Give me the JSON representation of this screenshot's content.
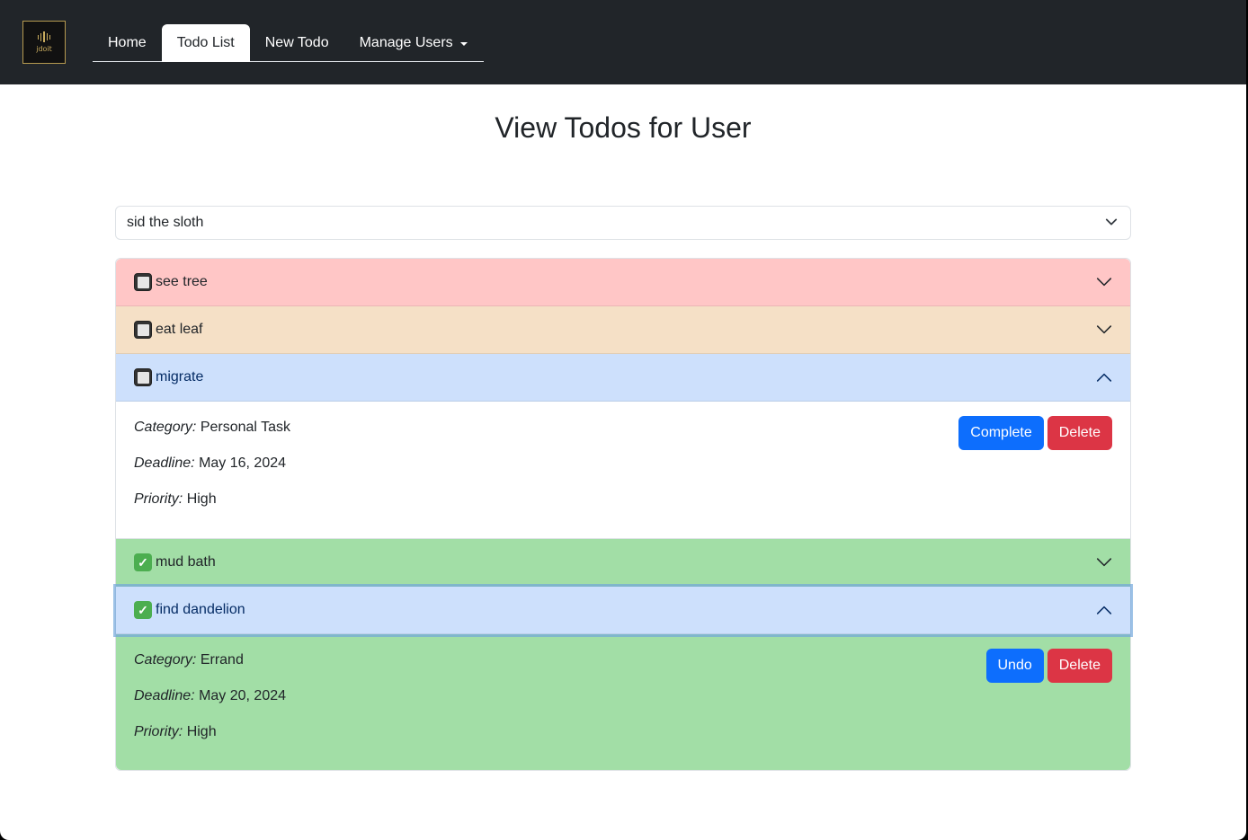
{
  "brand": {
    "logo_text": "jdoit"
  },
  "nav": {
    "tabs": [
      {
        "label": "Home"
      },
      {
        "label": "Todo List"
      },
      {
        "label": "New Todo"
      },
      {
        "label": "Manage Users"
      }
    ],
    "active_tab": "Todo List"
  },
  "page": {
    "title": "View Todos for User"
  },
  "user_select": {
    "selected": "sid the sloth"
  },
  "todos": [
    {
      "title": "see tree",
      "completed": false,
      "color": "#ffc6c6",
      "expanded": false
    },
    {
      "title": "eat leaf",
      "completed": false,
      "color": "#f5e0c6",
      "expanded": false
    },
    {
      "title": "migrate",
      "completed": false,
      "color": "#cde0fc",
      "expanded": true,
      "category_label": "Category:",
      "category": "Personal Task",
      "deadline_label": "Deadline:",
      "deadline": "May 16, 2024",
      "priority_label": "Priority:",
      "priority": "High",
      "primary_action": "Complete",
      "delete_action": "Delete"
    },
    {
      "title": "mud bath",
      "completed": true,
      "color": "#a2dea6",
      "expanded": false
    },
    {
      "title": "find dandelion",
      "completed": true,
      "color": "#cde0fc",
      "expanded": true,
      "category_label": "Category:",
      "category": "Errand",
      "deadline_label": "Deadline:",
      "deadline": "May 20, 2024",
      "priority_label": "Priority:",
      "priority": "High",
      "primary_action": "Undo",
      "delete_action": "Delete"
    }
  ],
  "colors": {
    "navbar": "#212529",
    "primary": "#0d6efd",
    "danger": "#dc3545",
    "logo_gold": "#c9ac5e"
  },
  "icons": {
    "unchecked": "empty-checkbox-icon",
    "checked": "check-mark-icon",
    "expand": "chevron-down-icon",
    "collapse": "chevron-up-icon"
  }
}
